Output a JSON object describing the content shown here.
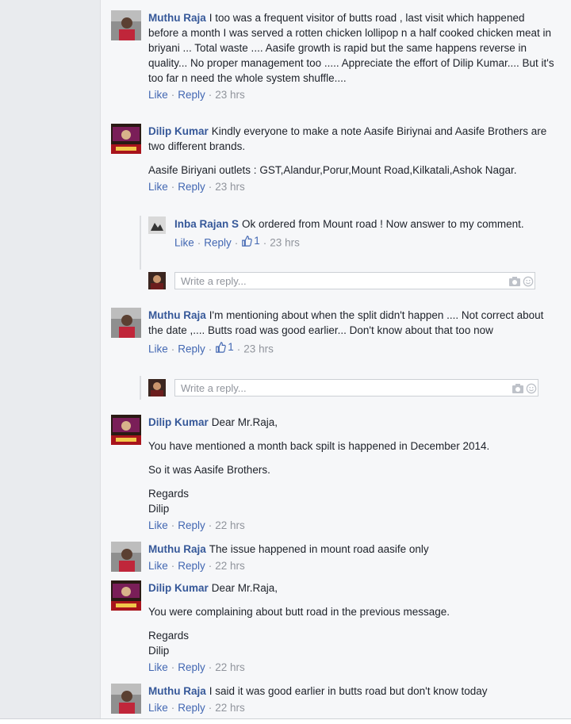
{
  "comments": [
    {
      "author": "Muthu Raja",
      "text": "I too was a frequent visitor of butts road , last visit which happened before a month I was served a rotten chicken lollipop n a half cooked chicken meat in briyani ... Total waste .... Aasife growth is rapid but the same happens reverse in quality... No proper management too ..... Appreciate the effort of Dilip Kumar.... But it's too far n need the whole system shuffle....",
      "like": "Like",
      "reply": "Reply",
      "time": "23 hrs"
    },
    {
      "author": "Dilip Kumar",
      "text": "Kindly everyone to make a note Aasife Biriynai and Aasife Brothers are two different brands.",
      "text2": "Aasife Biriyani outlets : GST,Alandur,Porur,Mount Road,Kilkatali,Ashok Nagar.",
      "like": "Like",
      "reply": "Reply",
      "time": "23 hrs"
    },
    {
      "author": "Inba Rajan S",
      "text": "Ok ordered from Mount road ! Now answer to my comment.",
      "like": "Like",
      "reply": "Reply",
      "likes_count": "1",
      "time": "23 hrs"
    },
    {
      "author": "Muthu Raja",
      "text": "I'm mentioning about when the split didn't happen .... Not correct about the date ,.... Butts road was good earlier... Don't know about that too now",
      "like": "Like",
      "reply": "Reply",
      "likes_count": "1",
      "time": "23 hrs"
    },
    {
      "author": "Dilip Kumar",
      "text": "Dear Mr.Raja,",
      "text2": "You have mentioned a month back spilt is happened in December 2014.",
      "text3": "So it was Aasife Brothers.",
      "text4": "Regards",
      "text5": "Dilip",
      "like": "Like",
      "reply": "Reply",
      "time": "22 hrs"
    },
    {
      "author": "Muthu Raja",
      "text": "The issue happened in mount road aasife only",
      "like": "Like",
      "reply": "Reply",
      "time": "22 hrs"
    },
    {
      "author": "Dilip Kumar",
      "text": "Dear Mr.Raja,",
      "text2": "You were complaining about butt road in the previous message.",
      "text3": "Regards",
      "text4": "Dilip",
      "like": "Like",
      "reply": "Reply",
      "time": "22 hrs"
    },
    {
      "author": "Muthu Raja",
      "text": "I said it was good earlier in butts road but don't know today",
      "like": "Like",
      "reply": "Reply",
      "time": "22 hrs"
    }
  ],
  "reply_placeholder": "Write a reply...",
  "icons": {
    "camera": "camera-icon",
    "emoji": "emoji-icon",
    "thumb": "thumbs-up-icon"
  },
  "colors": {
    "author": "#365899",
    "link": "#4267b2",
    "meta": "#90949c"
  }
}
